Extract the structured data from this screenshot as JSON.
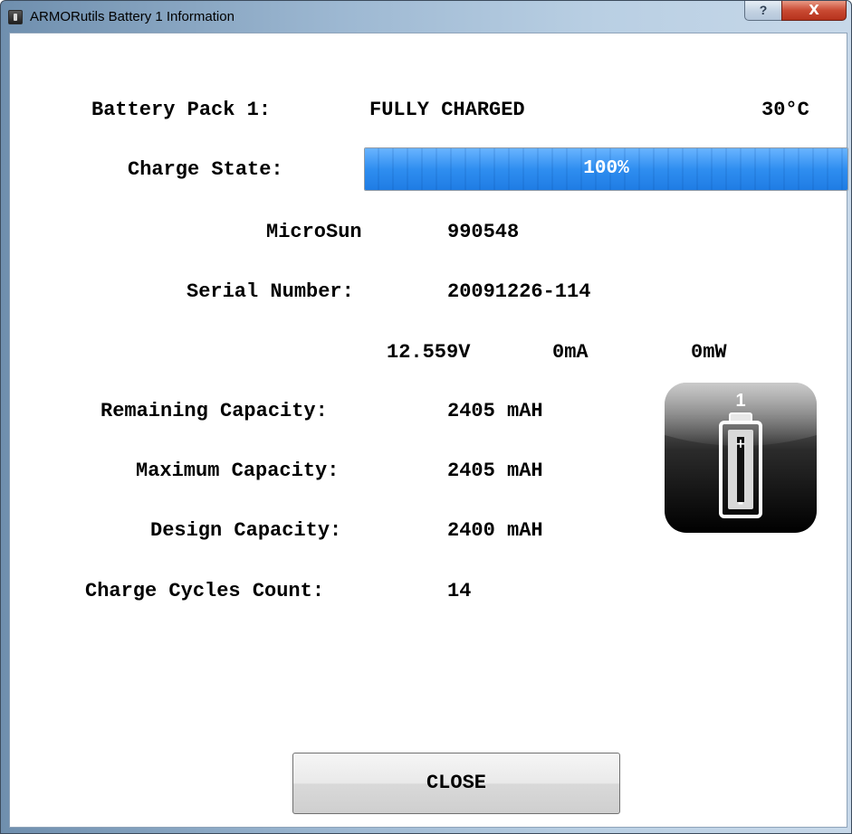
{
  "window": {
    "title": "ARMORutils Battery 1 Information",
    "help_glyph": "?",
    "close_glyph": "X"
  },
  "battery": {
    "pack_label": "Battery Pack 1:",
    "status": "FULLY CHARGED",
    "temperature": "30°C",
    "charge_label": "Charge State:",
    "charge_percent_text": "100%",
    "charge_fraction": 1.0,
    "manufacturer": "MicroSun",
    "model": "990548",
    "serial_label": "Serial Number:",
    "serial_value": "20091226-114",
    "voltage": "12.559V",
    "current": "0mA",
    "power": "0mW",
    "remaining_label": "Remaining Capacity:",
    "remaining_value": "2405 mAH",
    "maximum_label": "Maximum Capacity:",
    "maximum_value": "2405 mAH",
    "design_label": "Design Capacity:",
    "design_value": "2400 mAH",
    "cycles_label": "Charge Cycles Count:",
    "cycles_value": "14",
    "icon_number": "1",
    "icon_plus": "+",
    "icon_minus": "-"
  },
  "actions": {
    "close_label": "CLOSE"
  },
  "colors": {
    "progress_fill": "#2f8ef0",
    "title_close": "#c94a33"
  },
  "icons": {
    "app": "battery-app-icon",
    "help": "help-icon",
    "close": "close-icon",
    "battery": "battery-icon"
  }
}
